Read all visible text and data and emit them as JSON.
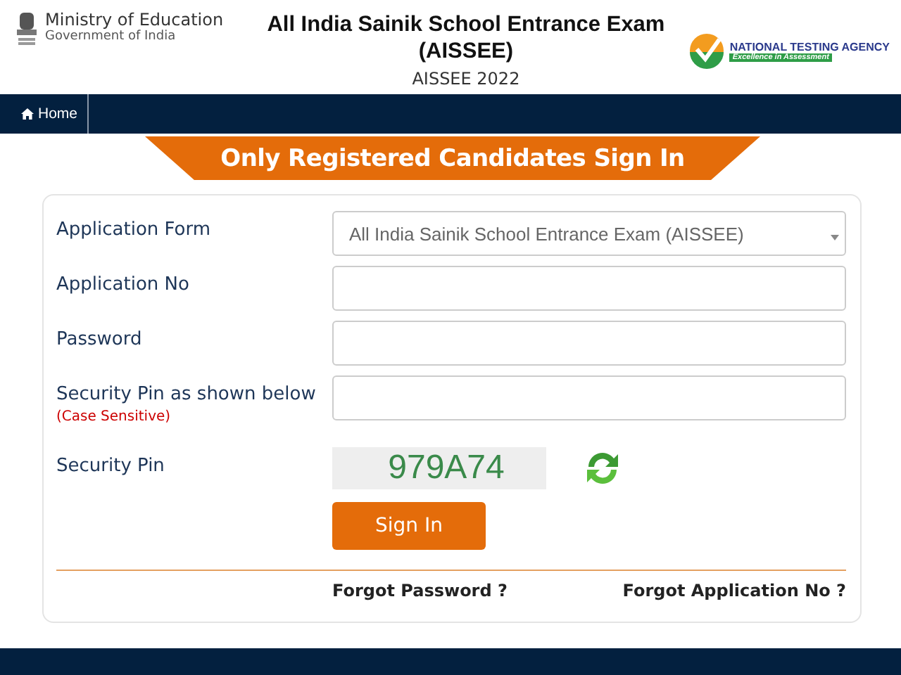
{
  "header": {
    "ministry": {
      "title": "Ministry of Education",
      "subtitle": "Government of India"
    },
    "exam_title": "All India Sainik School Entrance Exam (AISSEE)",
    "exam_subtitle": "AISSEE 2022",
    "agency": {
      "name": "NATIONAL TESTING AGENCY",
      "tagline": "Excellence in Assessment"
    }
  },
  "nav": [
    {
      "label": "Home"
    }
  ],
  "banner": "Only Registered Candidates Sign In",
  "fields": [
    {
      "kind": "select",
      "label": "Application Form",
      "value": "All India Sainik School Entrance Exam (AISSEE)"
    },
    {
      "kind": "input",
      "label": "Application No"
    },
    {
      "kind": "input",
      "label": "Password"
    },
    {
      "kind": "input",
      "label": "Security Pin as shown below",
      "note": "(Case Sensitive)"
    },
    {
      "kind": "captcha",
      "label": "Security Pin",
      "code": "979A74"
    }
  ],
  "button": "Sign In",
  "links": [
    "Forgot Password ?",
    "Forgot Application No ?"
  ]
}
